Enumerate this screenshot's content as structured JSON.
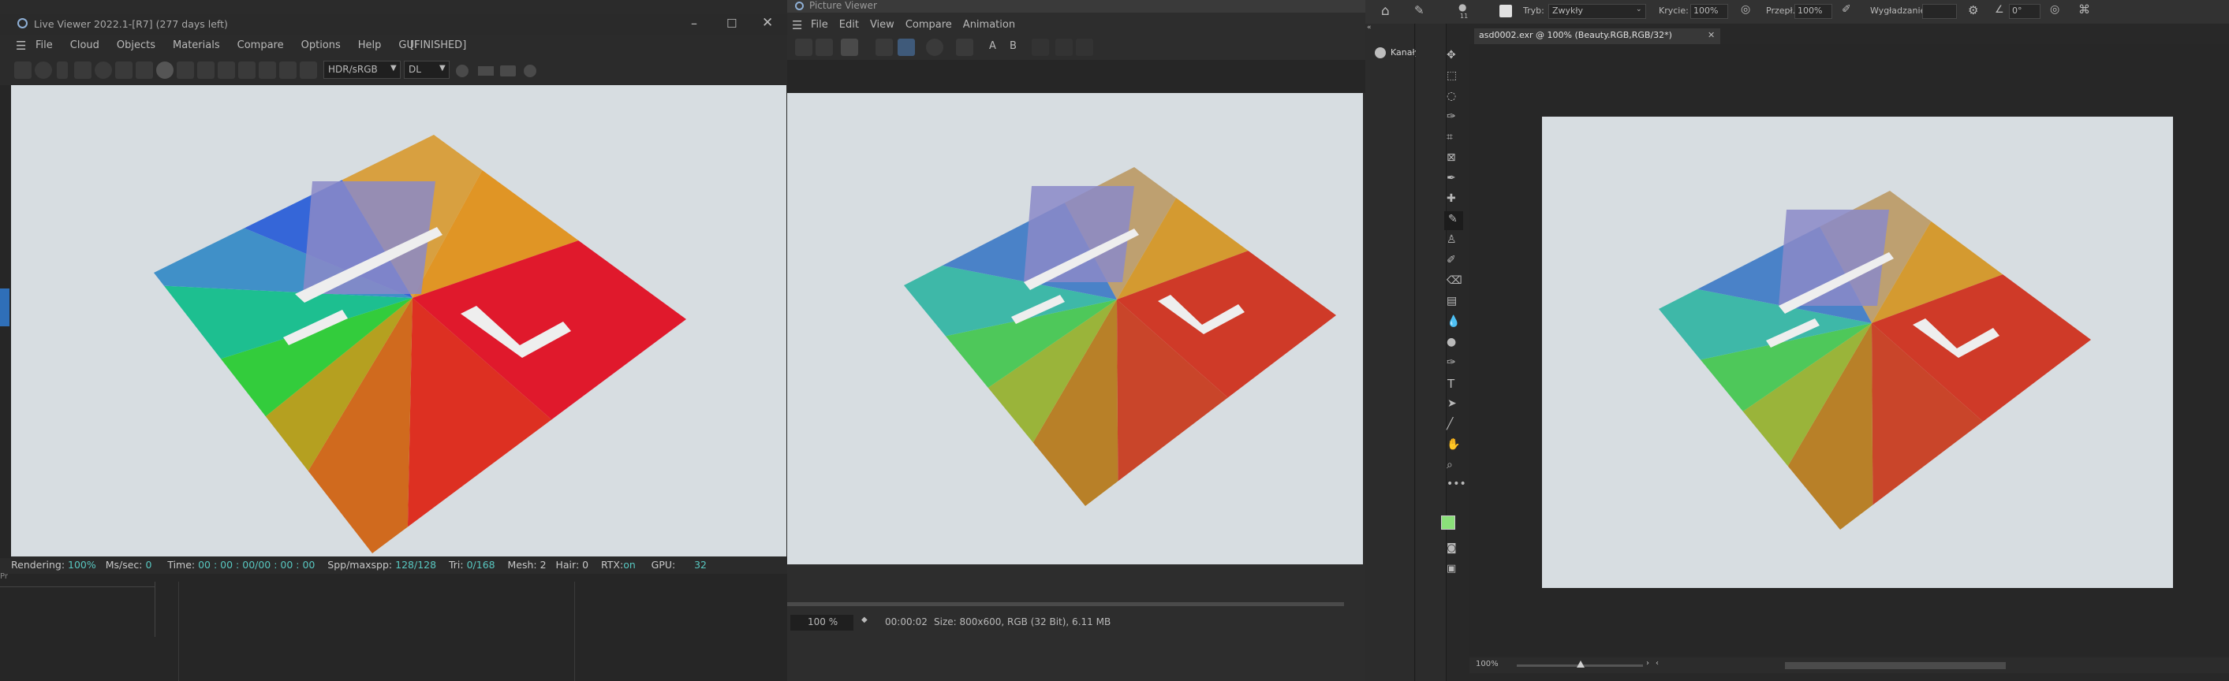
{
  "live_viewer": {
    "title": "Live Viewer 2022.1-[R7] (277 days left)",
    "menu": [
      "File",
      "Cloud",
      "Objects",
      "Materials",
      "Compare",
      "Options",
      "Help",
      "GUI"
    ],
    "state": "[FINISHED]",
    "color_mode": "HDR/sRGB",
    "render_mode": "DL",
    "status": {
      "rendering_label": "Rendering:",
      "rendering_value": "100%",
      "mssec_label": "Ms/sec:",
      "mssec_value": "0",
      "time_label": "Time:",
      "time_value": "00 : 00 : 00/00 : 00 : 00",
      "spp_label": "Spp/maxspp:",
      "spp_value": "128/128",
      "tri_label": "Tri:",
      "tri_value": "0/168",
      "mesh_label": "Mesh:",
      "mesh_value": "2",
      "hair_label": "Hair:",
      "hair_value": "0",
      "rtx_label": "RTX:",
      "rtx_value": "on",
      "gpu_label": "GPU:",
      "gpu_value": "32"
    },
    "side_tab": "Pr"
  },
  "picture_viewer": {
    "title": "Picture Viewer",
    "menu": [
      "File",
      "Edit",
      "View",
      "Compare",
      "Animation"
    ],
    "toolbar_letters": [
      "A",
      "B"
    ],
    "zoom": "100 %",
    "timecode": "00:00:02",
    "size_info": "Size: 800x600, RGB (32 Bit), 6.11 MB"
  },
  "photoshop": {
    "options": {
      "mode_label": "Tryb:",
      "mode_value": "Zwykły",
      "opacity_label": "Krycie:",
      "opacity_value": "100%",
      "flow_label": "Przepł.:",
      "flow_value": "100%",
      "smoothing_label": "Wygładzanie:",
      "angle_value": "0°",
      "brush_size": "11"
    },
    "panel_label": "Kanały",
    "document_tab": "asd0002.exr @ 100% (Beauty.RGB,RGB/32*)",
    "zoom_status": "100%",
    "foreground_color": "#8be07a",
    "background_color": "#111111"
  },
  "colors": {
    "canvas_bg": "#d7dde1",
    "accent_teal": "#58c7c0",
    "red_quadrant": "#e0192c"
  }
}
